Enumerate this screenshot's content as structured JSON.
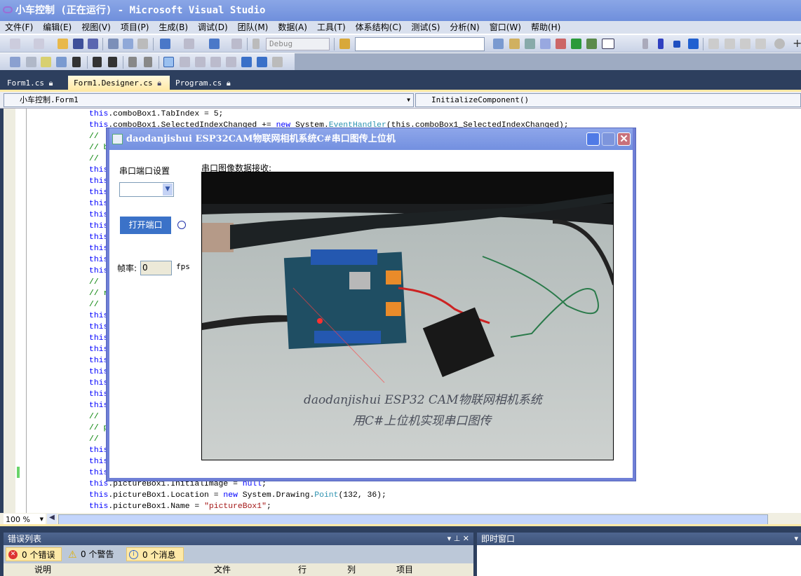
{
  "window": {
    "title": "小车控制 (正在运行) - Microsoft Visual Studio"
  },
  "menu": [
    "文件(F)",
    "编辑(E)",
    "视图(V)",
    "项目(P)",
    "生成(B)",
    "调试(D)",
    "团队(M)",
    "数据(A)",
    "工具(T)",
    "体系结构(C)",
    "测试(S)",
    "分析(N)",
    "窗口(W)",
    "帮助(H)"
  ],
  "toolbar": {
    "config": "Debug",
    "find_value": ""
  },
  "tabs": [
    {
      "label": "Form1.cs",
      "active": false
    },
    {
      "label": "Form1.Designer.cs",
      "active": true
    },
    {
      "label": "Program.cs",
      "active": false
    }
  ],
  "nav": {
    "class": "小车控制.Form1",
    "member": "InitializeComponent()"
  },
  "code": {
    "this": "this",
    "c1": "//",
    "c_b": "// b",
    "c_r": "// r",
    "c_p": "// p",
    "l1": ".comboBox1.TabIndex = 5;",
    "l2a": ".comboBox1.SelectedIndexChanged += ",
    "l2b": "new",
    "l2c": " System.",
    "l2d": "EventHandler",
    "l2e": "(this.comboBox1_SelectedIndexChanged);",
    "l34b": ".pictureBox1.InitialImage = ",
    "l34c": "null",
    "l34d": ";",
    "l35b": ".pictureBox1.Location = ",
    "l35c": "new",
    "l35d": " System.Drawing.",
    "l35e": "Point",
    "l35f": "(132, 36);",
    "l36b": ".pictureBox1.Name = ",
    "l36c": "\"pictureBox1\"",
    "l36d": ";"
  },
  "zoom": "100 %",
  "error_list": {
    "title": "错误列表",
    "errors": "0 个错误",
    "warnings": "0 个警告",
    "messages": "0 个消息",
    "columns": [
      "说明",
      "文件",
      "行",
      "列",
      "项目"
    ]
  },
  "immediate": {
    "title": "即时窗口"
  },
  "form": {
    "title": "daodanjishui ESP32CAM物联网相机系统C#串口图传上位机",
    "port_label": "串口端口设置",
    "port_value": "",
    "open_button": "打开端口",
    "fps_label": "帧率:",
    "fps_value": "0",
    "fps_unit": "fps",
    "image_label": "串口图像数据接收:",
    "photo_handwriting": [
      "daodanjishui ESP32 CAM物联网相机系统",
      "用C#上位机实现串口图传"
    ]
  }
}
